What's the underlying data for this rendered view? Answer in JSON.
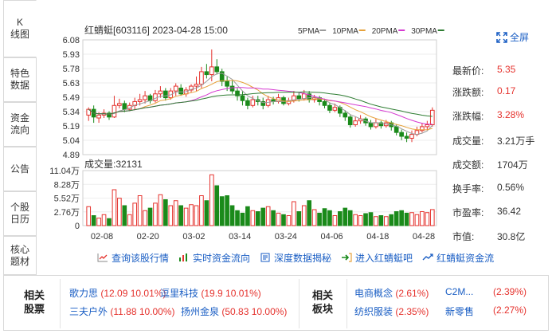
{
  "tabs": [
    {
      "label": "K\n线图",
      "active": true
    },
    {
      "label": "特色\n数据",
      "active": false
    },
    {
      "label": "资金\n流向",
      "active": false
    },
    {
      "label": "公告",
      "active": false
    },
    {
      "label": "个股\n日历",
      "active": false
    },
    {
      "label": "核心\n题材",
      "active": false
    }
  ],
  "chart": {
    "stock_title": "红蜻蜓[603116] 2023-04-28 15:00",
    "ma_legend": [
      {
        "label": "5PMA",
        "color": "#9b9b9b"
      },
      {
        "label": "10PMA",
        "color": "#e6a23c"
      },
      {
        "label": "20PMA",
        "color": "#d63ad1"
      },
      {
        "label": "30PMA",
        "color": "#2e7d32"
      }
    ],
    "price_ticks": [
      "6.08",
      "5.93",
      "5.78",
      "5.63",
      "5.49",
      "5.34",
      "5.19",
      "5.04",
      "4.89"
    ],
    "volume_label": "成交量:32131",
    "volume_ticks": [
      "11.04万",
      "8.28万",
      "5.52万",
      "2.76万",
      "0"
    ],
    "date_ticks": [
      "02-08",
      "02-20",
      "03-02",
      "03-14",
      "03-24",
      "04-06",
      "04-18",
      "04-28"
    ],
    "up_color": "#e5322d",
    "down_color": "#1a8a1a"
  },
  "chart_data": {
    "type": "candlestick",
    "price_range": [
      4.89,
      6.08
    ],
    "volume_range": [
      0,
      110400
    ],
    "candles": [
      {
        "o": 5.3,
        "c": 5.36,
        "h": 5.38,
        "l": 5.24,
        "v": 38000
      },
      {
        "o": 5.36,
        "c": 5.28,
        "h": 5.4,
        "l": 5.22,
        "v": 20000
      },
      {
        "o": 5.27,
        "c": 5.3,
        "h": 5.33,
        "l": 5.22,
        "v": 15000
      },
      {
        "o": 5.3,
        "c": 5.32,
        "h": 5.36,
        "l": 5.27,
        "v": 22000
      },
      {
        "o": 5.32,
        "c": 5.28,
        "h": 5.34,
        "l": 5.25,
        "v": 14000
      },
      {
        "o": 5.28,
        "c": 5.4,
        "h": 5.5,
        "l": 5.27,
        "v": 72000
      },
      {
        "o": 5.4,
        "c": 5.42,
        "h": 5.47,
        "l": 5.37,
        "v": 55000
      },
      {
        "o": 5.42,
        "c": 5.36,
        "h": 5.45,
        "l": 5.33,
        "v": 40000
      },
      {
        "o": 5.36,
        "c": 5.4,
        "h": 5.43,
        "l": 5.34,
        "v": 22000
      },
      {
        "o": 5.4,
        "c": 5.44,
        "h": 5.48,
        "l": 5.36,
        "v": 45000
      },
      {
        "o": 5.44,
        "c": 5.46,
        "h": 5.52,
        "l": 5.4,
        "v": 60000
      },
      {
        "o": 5.46,
        "c": 5.5,
        "h": 5.55,
        "l": 5.42,
        "v": 30000
      },
      {
        "o": 5.5,
        "c": 5.45,
        "h": 5.52,
        "l": 5.42,
        "v": 35000
      },
      {
        "o": 5.45,
        "c": 5.52,
        "h": 5.56,
        "l": 5.43,
        "v": 45000
      },
      {
        "o": 5.52,
        "c": 5.55,
        "h": 5.6,
        "l": 5.48,
        "v": 62000
      },
      {
        "o": 5.55,
        "c": 5.48,
        "h": 5.58,
        "l": 5.45,
        "v": 52000
      },
      {
        "o": 5.48,
        "c": 5.55,
        "h": 5.58,
        "l": 5.46,
        "v": 40000
      },
      {
        "o": 5.55,
        "c": 5.6,
        "h": 5.63,
        "l": 5.5,
        "v": 50000
      },
      {
        "o": 5.58,
        "c": 5.52,
        "h": 5.62,
        "l": 5.5,
        "v": 40000
      },
      {
        "o": 5.52,
        "c": 5.56,
        "h": 5.59,
        "l": 5.49,
        "v": 35000
      },
      {
        "o": 5.56,
        "c": 5.6,
        "h": 5.62,
        "l": 5.53,
        "v": 42000
      },
      {
        "o": 5.6,
        "c": 5.62,
        "h": 5.7,
        "l": 5.55,
        "v": 40000
      },
      {
        "o": 5.62,
        "c": 5.75,
        "h": 5.8,
        "l": 5.58,
        "v": 60000
      },
      {
        "o": 5.75,
        "c": 5.72,
        "h": 5.83,
        "l": 5.68,
        "v": 50000
      },
      {
        "o": 5.72,
        "c": 5.8,
        "h": 5.98,
        "l": 5.65,
        "v": 102000
      },
      {
        "o": 5.8,
        "c": 5.75,
        "h": 5.88,
        "l": 5.72,
        "v": 80000
      },
      {
        "o": 5.75,
        "c": 5.65,
        "h": 5.78,
        "l": 5.6,
        "v": 58000
      },
      {
        "o": 5.65,
        "c": 5.6,
        "h": 5.7,
        "l": 5.55,
        "v": 60000
      },
      {
        "o": 5.6,
        "c": 5.55,
        "h": 5.66,
        "l": 5.52,
        "v": 40000
      },
      {
        "o": 5.55,
        "c": 5.5,
        "h": 5.58,
        "l": 5.45,
        "v": 30000
      },
      {
        "o": 5.5,
        "c": 5.45,
        "h": 5.55,
        "l": 5.4,
        "v": 25000
      },
      {
        "o": 5.45,
        "c": 5.4,
        "h": 5.48,
        "l": 5.36,
        "v": 38000
      },
      {
        "o": 5.4,
        "c": 5.46,
        "h": 5.5,
        "l": 5.38,
        "v": 30000
      },
      {
        "o": 5.46,
        "c": 5.44,
        "h": 5.5,
        "l": 5.4,
        "v": 28000
      },
      {
        "o": 5.44,
        "c": 5.4,
        "h": 5.48,
        "l": 5.36,
        "v": 35000
      },
      {
        "o": 5.4,
        "c": 5.46,
        "h": 5.5,
        "l": 5.38,
        "v": 38000
      },
      {
        "o": 5.46,
        "c": 5.44,
        "h": 5.49,
        "l": 5.41,
        "v": 30000
      },
      {
        "o": 5.44,
        "c": 5.48,
        "h": 5.52,
        "l": 5.42,
        "v": 25000
      },
      {
        "o": 5.48,
        "c": 5.42,
        "h": 5.5,
        "l": 5.4,
        "v": 22000
      },
      {
        "o": 5.42,
        "c": 5.45,
        "h": 5.48,
        "l": 5.4,
        "v": 20000
      },
      {
        "o": 5.45,
        "c": 5.5,
        "h": 5.55,
        "l": 5.43,
        "v": 48000
      },
      {
        "o": 5.5,
        "c": 5.47,
        "h": 5.53,
        "l": 5.44,
        "v": 28000
      },
      {
        "o": 5.47,
        "c": 5.52,
        "h": 5.56,
        "l": 5.45,
        "v": 40000
      },
      {
        "o": 5.52,
        "c": 5.46,
        "h": 5.55,
        "l": 5.43,
        "v": 50000
      },
      {
        "o": 5.46,
        "c": 5.48,
        "h": 5.51,
        "l": 5.43,
        "v": 32000
      },
      {
        "o": 5.48,
        "c": 5.44,
        "h": 5.5,
        "l": 5.4,
        "v": 25000
      },
      {
        "o": 5.44,
        "c": 5.4,
        "h": 5.47,
        "l": 5.37,
        "v": 34000
      },
      {
        "o": 5.4,
        "c": 5.35,
        "h": 5.43,
        "l": 5.32,
        "v": 30000
      },
      {
        "o": 5.35,
        "c": 5.38,
        "h": 5.42,
        "l": 5.33,
        "v": 20000
      },
      {
        "o": 5.38,
        "c": 5.32,
        "h": 5.4,
        "l": 5.28,
        "v": 28000
      },
      {
        "o": 5.32,
        "c": 5.28,
        "h": 5.35,
        "l": 5.24,
        "v": 35000
      },
      {
        "o": 5.28,
        "c": 5.2,
        "h": 5.3,
        "l": 5.17,
        "v": 30000
      },
      {
        "o": 5.2,
        "c": 5.24,
        "h": 5.28,
        "l": 5.18,
        "v": 22000
      },
      {
        "o": 5.24,
        "c": 5.26,
        "h": 5.3,
        "l": 5.21,
        "v": 20000
      },
      {
        "o": 5.26,
        "c": 5.22,
        "h": 5.28,
        "l": 5.19,
        "v": 24000
      },
      {
        "o": 5.22,
        "c": 5.18,
        "h": 5.25,
        "l": 5.15,
        "v": 26000
      },
      {
        "o": 5.18,
        "c": 5.22,
        "h": 5.26,
        "l": 5.16,
        "v": 18000
      },
      {
        "o": 5.22,
        "c": 5.19,
        "h": 5.24,
        "l": 5.16,
        "v": 20000
      },
      {
        "o": 5.19,
        "c": 5.22,
        "h": 5.25,
        "l": 5.17,
        "v": 18000
      },
      {
        "o": 5.22,
        "c": 5.18,
        "h": 5.24,
        "l": 5.14,
        "v": 22000
      },
      {
        "o": 5.18,
        "c": 5.12,
        "h": 5.2,
        "l": 5.09,
        "v": 28000
      },
      {
        "o": 5.12,
        "c": 5.08,
        "h": 5.15,
        "l": 5.04,
        "v": 30000
      },
      {
        "o": 5.08,
        "c": 5.06,
        "h": 5.12,
        "l": 5.02,
        "v": 25000
      },
      {
        "o": 5.06,
        "c": 5.1,
        "h": 5.14,
        "l": 5.02,
        "v": 26000
      },
      {
        "o": 5.1,
        "c": 5.14,
        "h": 5.18,
        "l": 5.08,
        "v": 22000
      },
      {
        "o": 5.14,
        "c": 5.18,
        "h": 5.22,
        "l": 5.12,
        "v": 28000
      },
      {
        "o": 5.18,
        "c": 5.2,
        "h": 5.24,
        "l": 5.15,
        "v": 26000
      },
      {
        "o": 5.2,
        "c": 5.35,
        "h": 5.38,
        "l": 5.18,
        "v": 32131
      }
    ]
  },
  "info": [
    {
      "label": "最新价:",
      "value": "5.35",
      "red": true
    },
    {
      "label": "涨跌额:",
      "value": "0.17",
      "red": true
    },
    {
      "label": "涨跌幅:",
      "value": "3.28%",
      "red": true
    },
    {
      "label": "成交量:",
      "value": "3.21万手",
      "red": false
    },
    {
      "label": "成交额:",
      "value": "1704万",
      "red": false
    },
    {
      "label": "换手率:",
      "value": "0.56%",
      "red": false
    },
    {
      "label": "市盈率:",
      "value": "36.42",
      "red": false
    },
    {
      "label": "市值:",
      "value": "30.8亿",
      "red": false
    }
  ],
  "fullscreen_label": "全屏",
  "links": [
    {
      "label": "查询该股行情",
      "icon": "line-chart-icon"
    },
    {
      "label": "实时资金流向",
      "icon": "bar-chart-icon"
    },
    {
      "label": "深度数据揭秘",
      "icon": "document-icon"
    },
    {
      "label": "进入红蜻蜓吧",
      "icon": "arrow-enter-icon"
    },
    {
      "label": "红蜻蜓资金流",
      "icon": "money-flow-icon"
    }
  ],
  "related_stocks": {
    "title": "相关\n股票",
    "items": [
      {
        "name": "歌力思",
        "detail": "(12.09 10.01%)"
      },
      {
        "name": "逗里科技",
        "detail": "(19.9 10.01%)"
      },
      {
        "name": "三夫户外",
        "detail": "(11.88 10.00%)"
      },
      {
        "name": "扬州金泉",
        "detail": "(50.83 10.00%)"
      }
    ]
  },
  "related_sectors": {
    "title": "相关\n板块",
    "items": [
      {
        "name": "电商概念",
        "detail": "(2.61%)"
      },
      {
        "name": "C2M...",
        "detail": "(2.39%)"
      },
      {
        "name": "纺织服装",
        "detail": "(2.35%)"
      },
      {
        "name": "新零售",
        "detail": "(2.27%)"
      }
    ]
  }
}
